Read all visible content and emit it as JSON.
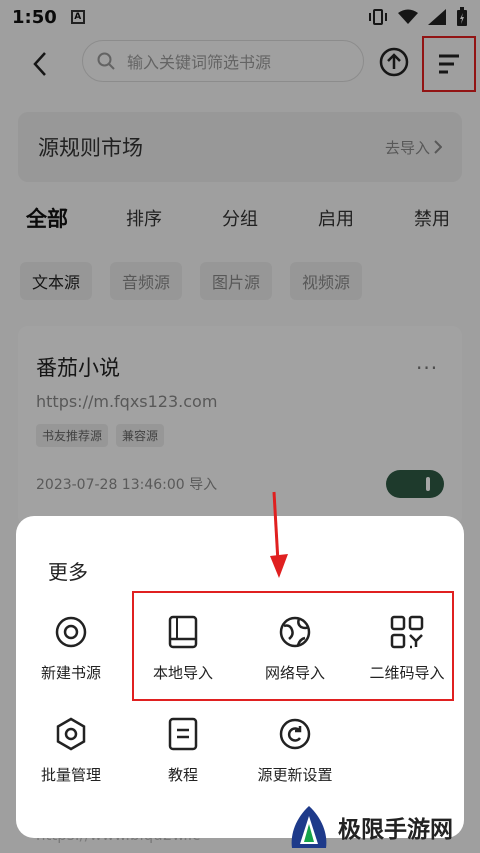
{
  "status": {
    "time": "1:50",
    "notif": "A"
  },
  "header": {
    "search_placeholder": "输入关键词筛选书源"
  },
  "market": {
    "title": "源规则市场",
    "action": "去导入"
  },
  "filter_tabs": [
    "全部",
    "排序",
    "分组",
    "启用",
    "禁用"
  ],
  "type_chips": [
    "文本源",
    "音频源",
    "图片源",
    "视频源"
  ],
  "source": {
    "name": "番茄小说",
    "url": "https://m.fqxs123.com",
    "tags": [
      "书友推荐源",
      "兼容源"
    ],
    "date": "2023-07-28 13:46:00 导入",
    "more": "···",
    "enabled": true
  },
  "sheet": {
    "title": "更多",
    "actions": [
      {
        "label": "新建书源",
        "icon": "target-icon"
      },
      {
        "label": "本地导入",
        "icon": "book-icon"
      },
      {
        "label": "网络导入",
        "icon": "globe-icon"
      },
      {
        "label": "二维码导入",
        "icon": "qr-code-icon"
      },
      {
        "label": "批量管理",
        "icon": "hexagon-icon"
      },
      {
        "label": "教程",
        "icon": "document-icon"
      },
      {
        "label": "源更新设置",
        "icon": "refresh-icon"
      }
    ]
  },
  "background_url": "https://www.biqu2w.ic",
  "watermark": {
    "text": "极限手游网"
  },
  "colors": {
    "highlight": "#e02020",
    "toggle": "#2f5a44"
  }
}
